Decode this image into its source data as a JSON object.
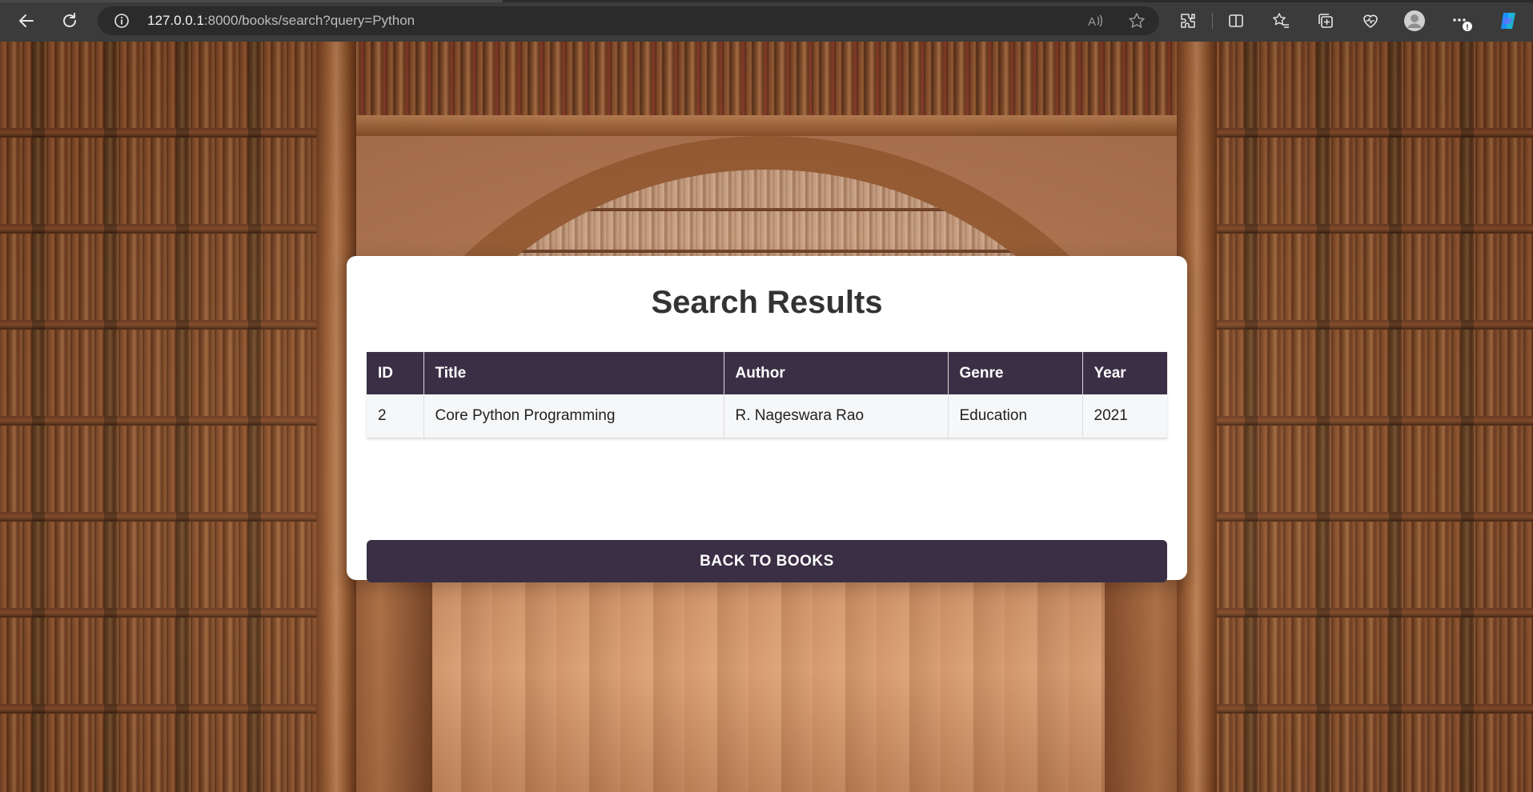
{
  "browser": {
    "url_host": "127.0.0.1",
    "url_rest": ":8000/books/search?query=Python"
  },
  "page": {
    "heading": "Search Results",
    "table": {
      "headers": [
        "ID",
        "Title",
        "Author",
        "Genre",
        "Year"
      ],
      "rows": [
        [
          "2",
          "Core Python Programming",
          "R. Nageswara Rao",
          "Education",
          "2021"
        ]
      ]
    },
    "back_button_label": "BACK TO BOOKS"
  },
  "colors": {
    "accent": "#3a2f45",
    "card_bg": "#ffffff",
    "browser_bar": "#3b3b3b"
  },
  "icons": {
    "back": "arrow-left-icon",
    "refresh": "refresh-icon",
    "site_info": "info-icon",
    "read_aloud": "read-aloud-icon",
    "favorite": "star-icon",
    "extensions": "puzzle-icon",
    "split_screen": "split-screen-icon",
    "favorites": "favorites-icon",
    "collections": "collections-icon",
    "health": "heart-icon",
    "profile": "profile-icon",
    "more": "more-icon",
    "copilot": "copilot-icon"
  }
}
